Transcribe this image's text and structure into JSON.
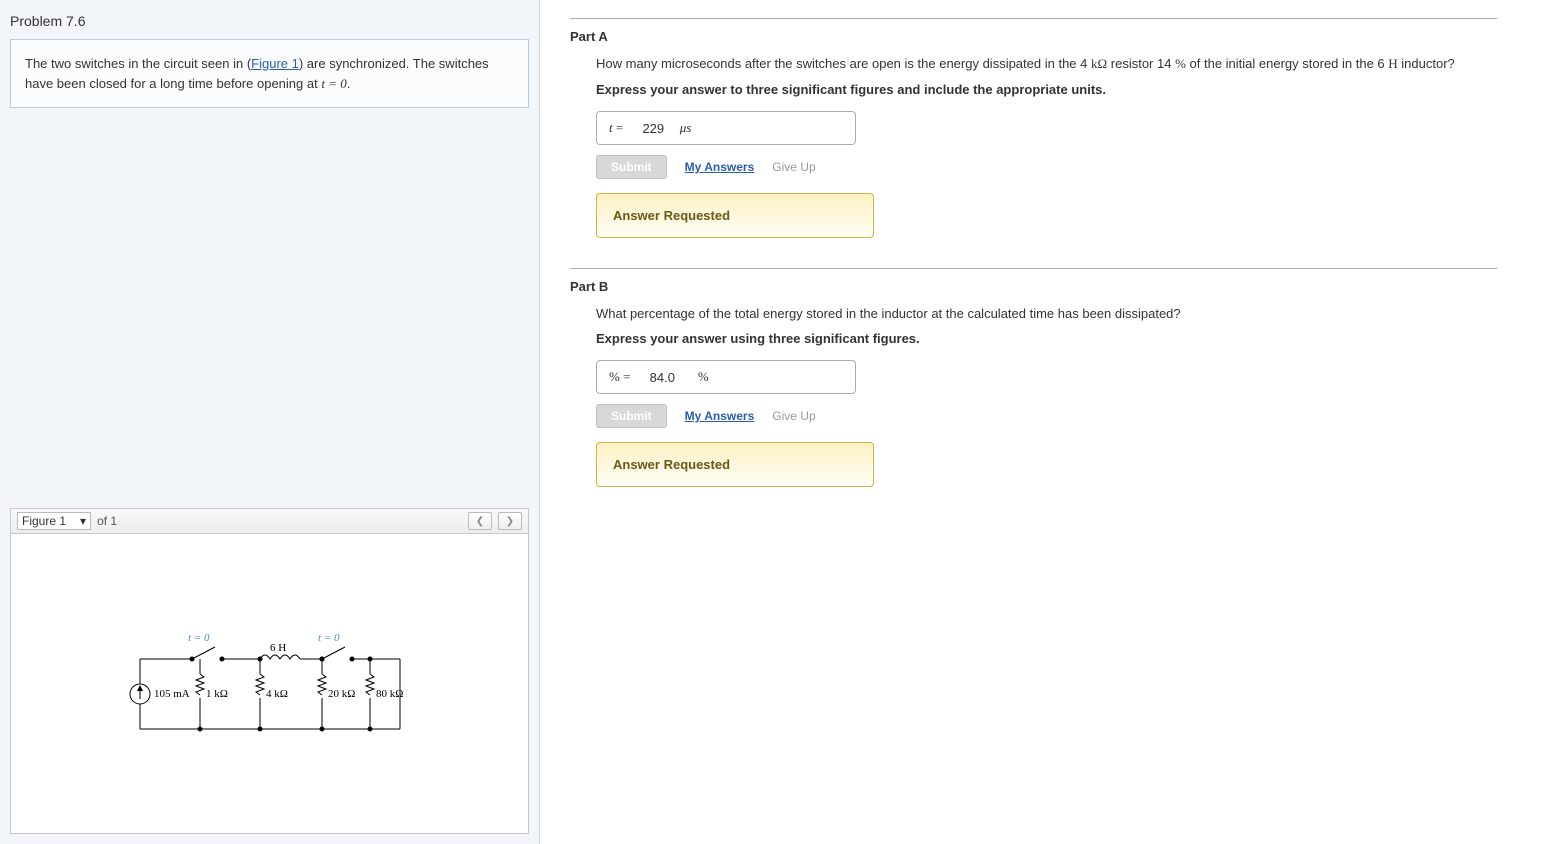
{
  "problem": {
    "title": "Problem 7.6",
    "desc_pre": "The two switches in the circuit seen in (",
    "figure_link": "Figure 1",
    "desc_post": ") are synchronized. The switches have been closed for a long time before opening at ",
    "desc_math": "t = 0",
    "desc_end": "."
  },
  "figure": {
    "selector_label": "Figure 1",
    "of_text": "of 1",
    "circuit": {
      "t_label": "t = 0",
      "inductor": "6 H",
      "source": "105 mA",
      "r1": "1 kΩ",
      "r2": "4 kΩ",
      "r3": "20 kΩ",
      "r4": "80 kΩ"
    }
  },
  "parts": [
    {
      "title": "Part A",
      "question_pre": "How many microseconds after the switches are open is the energy dissipated in the 4 ",
      "q_unit1": "kΩ",
      "question_mid": " resistor 14 ",
      "q_unit2": "%",
      "question_mid2": " of the initial energy stored in the 6 ",
      "q_unit3": "H",
      "question_end": " inductor?",
      "instruction": "Express your answer to three significant figures and include the appropriate units.",
      "answer_var": "t",
      "answer_eq": "=",
      "answer_val": "229",
      "answer_unit": "μs",
      "submit": "Submit",
      "my_answers": "My Answers",
      "give_up": "Give Up",
      "status": "Answer Requested"
    },
    {
      "title": "Part B",
      "question": "What percentage of the total energy stored in the inductor at the calculated time has been dissipated?",
      "instruction": "Express your answer using three significant figures.",
      "answer_var": "%",
      "answer_eq": "=",
      "answer_val": "84.0",
      "answer_unit": "%",
      "submit": "Submit",
      "my_answers": "My Answers",
      "give_up": "Give Up",
      "status": "Answer Requested"
    }
  ]
}
